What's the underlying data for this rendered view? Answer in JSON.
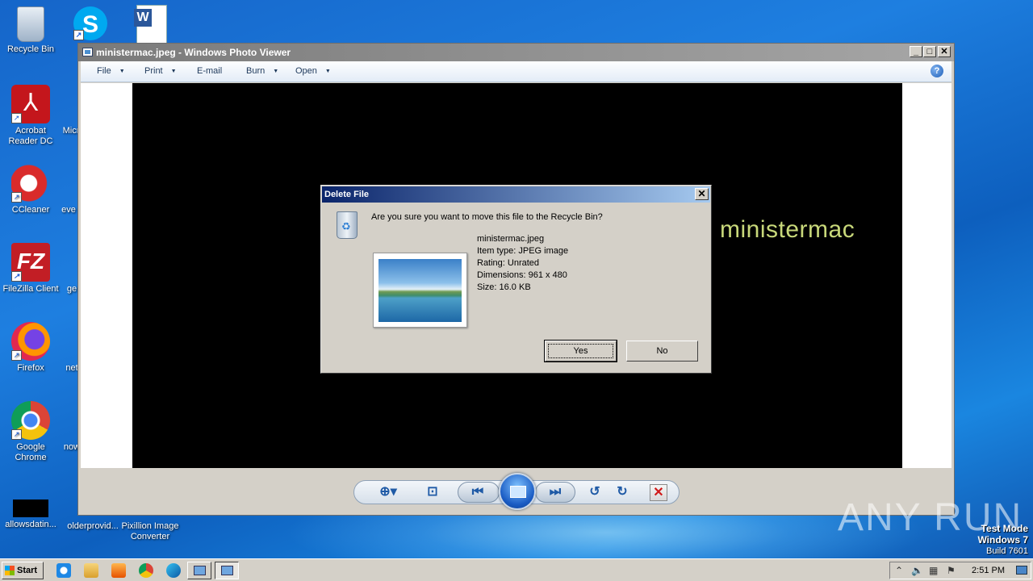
{
  "desktop": {
    "icons": [
      {
        "label": "Recycle Bin",
        "icon": "recycle-bin-icon"
      },
      {
        "label": "Acrobat Reader DC",
        "icon": "acrobat-icon"
      },
      {
        "label": "CCleaner",
        "icon": "ccleaner-icon"
      },
      {
        "label": "FileZilla Client",
        "icon": "filezilla-icon"
      },
      {
        "label": "Firefox",
        "icon": "firefox-icon"
      },
      {
        "label": "Google Chrome",
        "icon": "chrome-icon"
      },
      {
        "label": "allowsdatin...",
        "icon": "file-icon"
      },
      {
        "label": "Micr",
        "icon": "edge-icon"
      },
      {
        "label": "eve",
        "icon": "file-icon"
      },
      {
        "label": "ge",
        "icon": "file-icon"
      },
      {
        "label": "net",
        "icon": "file-icon"
      },
      {
        "label": "now",
        "icon": "file-icon"
      },
      {
        "label": "olderprovid...",
        "icon": "file-icon"
      },
      {
        "label": "Pixillion Image Converter",
        "icon": "pixillion-icon"
      },
      {
        "label": "",
        "icon": "skype-icon"
      },
      {
        "label": "",
        "icon": "word-icon"
      }
    ]
  },
  "photo_viewer": {
    "title": "ministermac.jpeg - Windows Photo Viewer",
    "menu": [
      {
        "label": "File",
        "has_dropdown": true
      },
      {
        "label": "Print",
        "has_dropdown": true
      },
      {
        "label": "E-mail",
        "has_dropdown": false
      },
      {
        "label": "Burn",
        "has_dropdown": true
      },
      {
        "label": "Open",
        "has_dropdown": true
      }
    ],
    "help_label": "?",
    "image_text": "ministermac",
    "controls": [
      "zoom-icon",
      "actual-size-icon",
      "previous-icon",
      "slideshow-icon",
      "next-icon",
      "rotate-left-icon",
      "rotate-right-icon",
      "delete-icon"
    ]
  },
  "dialog": {
    "title": "Delete File",
    "question": "Are you sure you want to move this file to the Recycle Bin?",
    "file_name": "ministermac.jpeg",
    "item_type": "Item type: JPEG image",
    "rating": "Rating: Unrated",
    "dimensions": "Dimensions: 961 x 480",
    "size": "Size: 16.0 KB",
    "yes_label": "Yes",
    "no_label": "No",
    "close_label": "✕"
  },
  "taskbar": {
    "start_label": "Start",
    "clock": "2:51 PM"
  },
  "watermark": {
    "brand": "ANY RUN",
    "test_mode": "Test Mode",
    "os": "Windows 7",
    "build": "Build 7601"
  },
  "colors": {
    "dialog_title_start": "#0a246a",
    "dialog_title_end": "#a6caf0",
    "image_text": "#c8d87a"
  }
}
